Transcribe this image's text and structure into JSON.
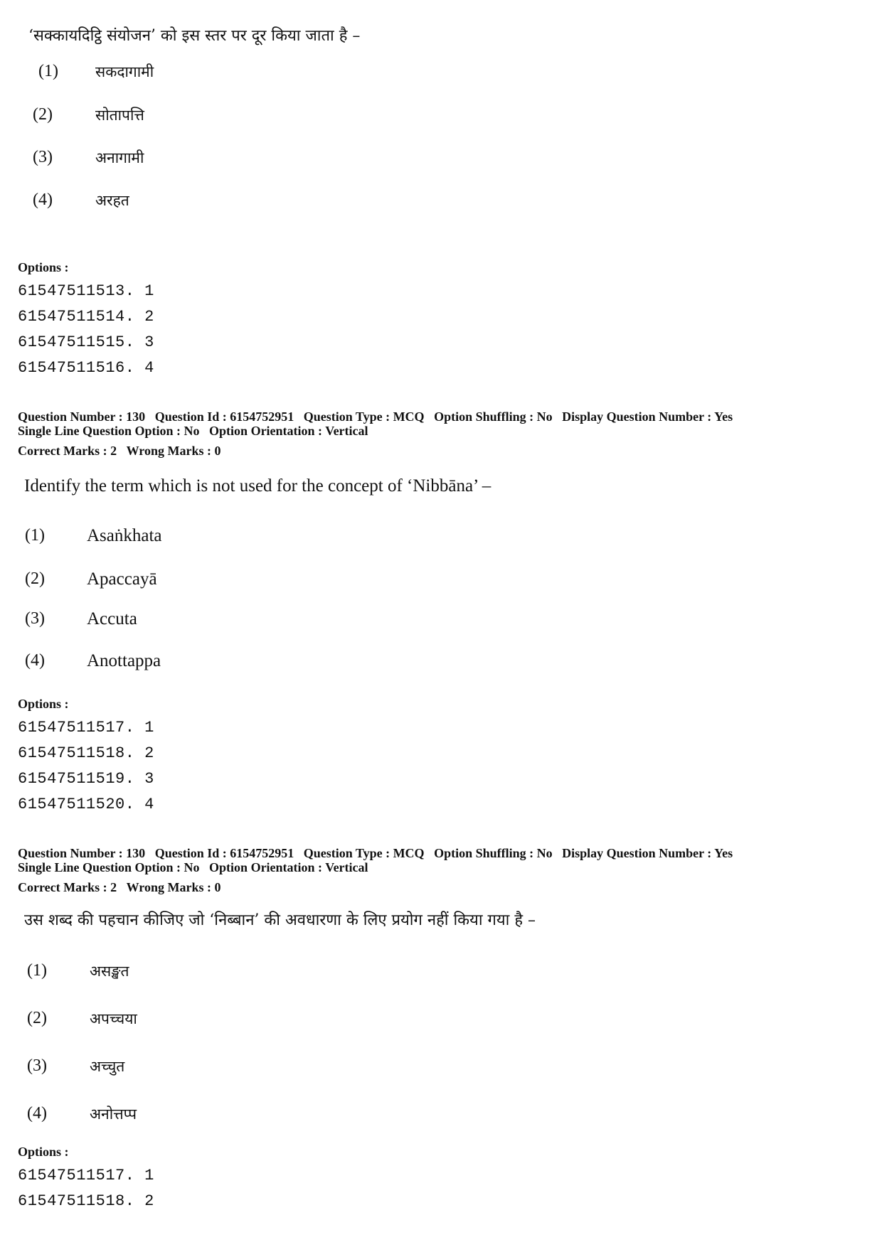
{
  "blocks": [
    {
      "question_text": "‘सक्कायदिट्ठि संयोजन’ को इस स्तर पर दूर किया जाता है –",
      "choices": [
        {
          "num": "(1)",
          "text": "सकदागामी"
        },
        {
          "num": "(2)",
          "text": "सोतापत्ति"
        },
        {
          "num": "(3)",
          "text": "अनागामी"
        },
        {
          "num": "(4)",
          "text": "अरहत"
        }
      ],
      "options_label": "Options :",
      "option_ids": [
        "61547511513. 1",
        "61547511514. 2",
        "61547511515. 3",
        "61547511516. 4"
      ]
    },
    {
      "meta": {
        "question_number": "Question Number : 130",
        "question_id": "Question Id : 6154752951",
        "question_type": "Question Type : MCQ",
        "option_shuffling": "Option Shuffling : No",
        "display_question_number": "Display Question Number : Yes",
        "single_line": "Single Line Question Option : No",
        "orientation": "Option Orientation : Vertical",
        "correct_marks": "Correct Marks : 2",
        "wrong_marks": "Wrong Marks : 0"
      },
      "question_text": "Identify the term which is not used for the concept of ‘Nibbāna’ –",
      "choices": [
        {
          "num": "(1)",
          "text": "Asaṅkhata"
        },
        {
          "num": "(2)",
          "text": "Apaccayā"
        },
        {
          "num": "(3)",
          "text": "Accuta"
        },
        {
          "num": "(4)",
          "text": "Anottappa"
        }
      ],
      "options_label": "Options :",
      "option_ids": [
        "61547511517. 1",
        "61547511518. 2",
        "61547511519. 3",
        "61547511520. 4"
      ]
    },
    {
      "meta": {
        "question_number": "Question Number : 130",
        "question_id": "Question Id : 6154752951",
        "question_type": "Question Type : MCQ",
        "option_shuffling": "Option Shuffling : No",
        "display_question_number": "Display Question Number : Yes",
        "single_line": "Single Line Question Option : No",
        "orientation": "Option Orientation : Vertical",
        "correct_marks": "Correct Marks : 2",
        "wrong_marks": "Wrong Marks : 0"
      },
      "question_text": "उस शब्द की पहचान कीजिए जो ‘निब्बान’ की अवधारणा के लिए प्रयोग नहीं किया गया है –",
      "choices": [
        {
          "num": "(1)",
          "text": "असङ्खत"
        },
        {
          "num": "(2)",
          "text": "अपच्चया"
        },
        {
          "num": "(3)",
          "text": "अच्चुत"
        },
        {
          "num": "(4)",
          "text": "अनोत्तप्प"
        }
      ],
      "options_label": "Options :",
      "option_ids": [
        "61547511517. 1",
        "61547511518. 2"
      ]
    }
  ]
}
